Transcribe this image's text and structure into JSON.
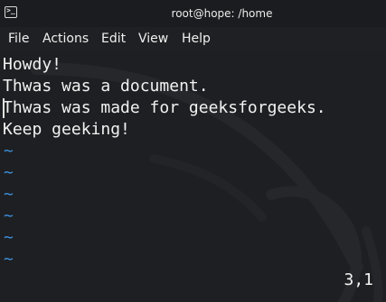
{
  "window": {
    "title": "root@hope: /home",
    "icon": "terminal-icon",
    "icon_glyph": ">_"
  },
  "menu": {
    "items": [
      "File",
      "Actions",
      "Edit",
      "View",
      "Help"
    ]
  },
  "editor": {
    "lines": [
      "Howdy!",
      "Thwas was a document.",
      "Thwas was made for geeksforgeeks.",
      "Keep geeking!"
    ],
    "empty_line_marker": "~",
    "cursor_position": "3,1"
  },
  "colors": {
    "background": "#1e1f22",
    "text": "#f2f2f2",
    "tilde": "#3b8fd9"
  }
}
